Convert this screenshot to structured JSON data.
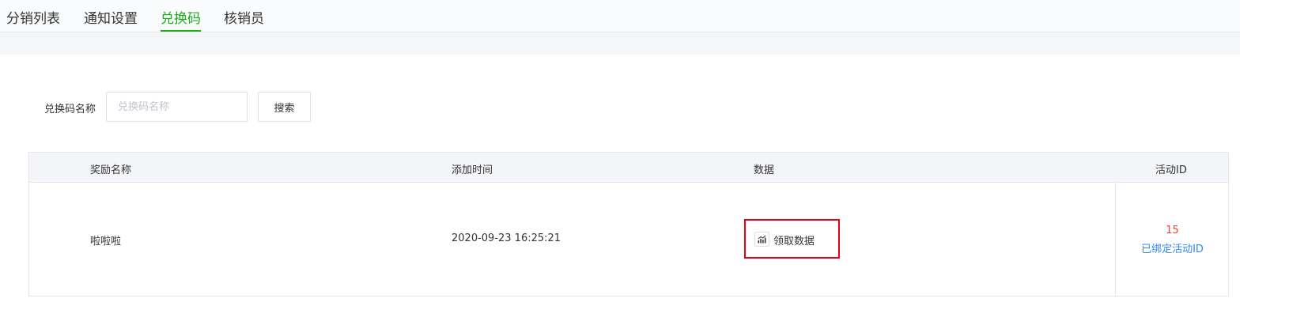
{
  "tabs": [
    {
      "label": "分销列表",
      "active": false
    },
    {
      "label": "通知设置",
      "active": false
    },
    {
      "label": "兑换码",
      "active": true
    },
    {
      "label": "核销员",
      "active": false
    }
  ],
  "search": {
    "label": "兑换码名称",
    "placeholder": "兑换码名称",
    "value": "",
    "button_label": "搜索"
  },
  "table": {
    "headers": {
      "name": "奖励名称",
      "time": "添加时间",
      "data": "数据",
      "activity_id": "活动ID"
    },
    "rows": [
      {
        "name": "啦啦啦",
        "time": "2020-09-23 16:25:21",
        "data_link": "领取数据",
        "data_icon": "chart-icon",
        "activity_count": "15",
        "activity_link": "已绑定活动ID"
      }
    ]
  },
  "colors": {
    "accent": "#1aad19",
    "highlight_border": "#e60012",
    "count": "#f04134",
    "link": "#3388ff"
  }
}
